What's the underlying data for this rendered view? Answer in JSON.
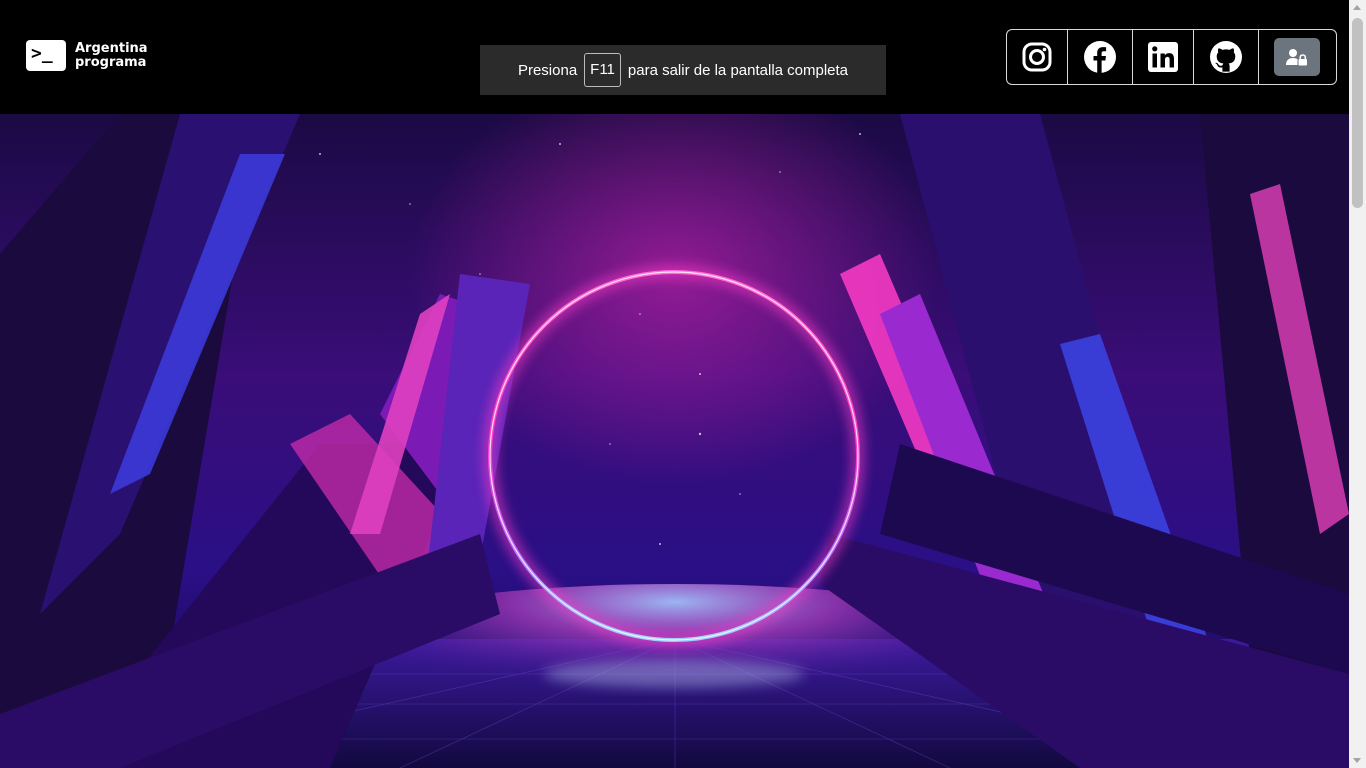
{
  "logo": {
    "line1": "Argentina",
    "line2": "programa",
    "symbol": ">_"
  },
  "fullscreen_notice": {
    "before": "Presiona",
    "key": "F11",
    "after": "para salir de la pantalla completa"
  },
  "social": [
    {
      "icon": "instagram-icon"
    },
    {
      "icon": "facebook-icon"
    },
    {
      "icon": "linkedin-icon"
    },
    {
      "icon": "github-icon"
    },
    {
      "icon": "user-lock-icon"
    }
  ],
  "colors": {
    "topbar": "#000000",
    "login_button": "#6c757d",
    "ring_pink": "#ff3cc8",
    "ring_blue": "#5a8cff"
  }
}
